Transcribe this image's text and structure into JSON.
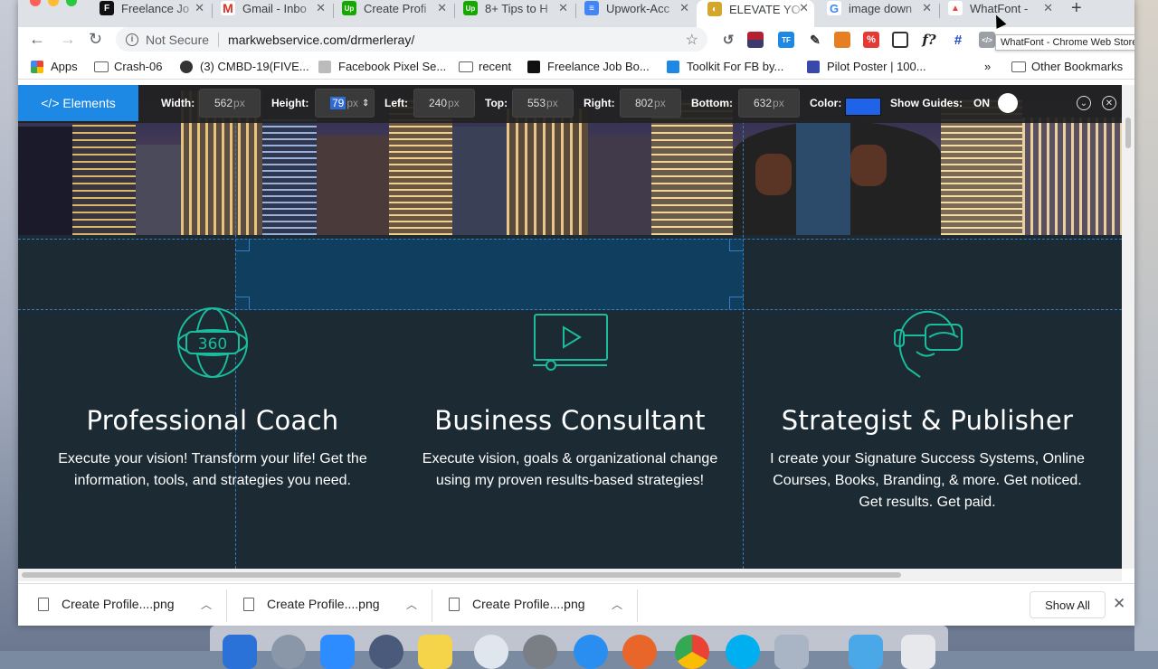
{
  "browser": {
    "tabs": [
      {
        "title": "Freelance Jo",
        "fav": "F",
        "favColor": "#111"
      },
      {
        "title": "Gmail - Inbo",
        "fav": "M",
        "favColor": "#d93025"
      },
      {
        "title": "Create Profi",
        "fav": "Up",
        "favColor": "#14a800"
      },
      {
        "title": "8+ Tips to H",
        "fav": "Up",
        "favColor": "#14a800"
      },
      {
        "title": "Upwork-Acc",
        "fav": "≡",
        "favColor": "#4285f4"
      },
      {
        "title": "ELEVATE YO",
        "fav": "◐",
        "favColor": "#d4a62a"
      },
      {
        "title": "image down",
        "fav": "G",
        "favColor": "#4285f4"
      },
      {
        "title": "WhatFont -",
        "fav": "▲",
        "favColor": "#e94335"
      }
    ],
    "security_label": "Not Secure",
    "url": "markwebservice.com/drmerleray/",
    "tooltip": "WhatFont - Chrome Web Store",
    "bookmarks": [
      {
        "label": "Apps",
        "icon": "apps-grid-icon"
      },
      {
        "label": "Crash-06",
        "icon": "folder-icon"
      },
      {
        "label": "(3) CMBD-19(FIVE...",
        "icon": "site-icon"
      },
      {
        "label": "Facebook Pixel Se...",
        "icon": "site-icon"
      },
      {
        "label": "recent",
        "icon": "folder-icon"
      },
      {
        "label": "Freelance Job Bo...",
        "icon": "freelancer-icon"
      },
      {
        "label": "Toolkit For FB by...",
        "icon": "toolkit-icon"
      },
      {
        "label": "Pilot Poster | 100...",
        "icon": "pilot-icon"
      }
    ],
    "bookmarks_more": "»",
    "other_bookmarks": "Other Bookmarks"
  },
  "whatfont": {
    "logo": "</> Elements",
    "width_label": "Width:",
    "width_value": "562",
    "height_label": "Height:",
    "height_value": "79",
    "left_label": "Left:",
    "left_value": "240",
    "top_label": "Top:",
    "top_value": "553",
    "right_label": "Right:",
    "right_value": "802",
    "bottom_label": "Bottom:",
    "bottom_value": "632",
    "unit": "px",
    "color_label": "Color:",
    "guide_color": "#1f63e8",
    "guides_label": "Show Guides:",
    "guides_state": "ON"
  },
  "services": [
    {
      "title": "Professional Coach",
      "text": "Execute your vision! Transform your life! Get the information, tools, and strategies you need.",
      "icon": "360-globe-icon"
    },
    {
      "title": "Business Consultant",
      "text": "Execute vision, goals & organizational change using my proven results-based strategies!",
      "icon": "video-play-icon"
    },
    {
      "title": "Strategist & Publisher",
      "text": "I create your Signature Success Systems, Online Courses, Books, Branding, & more. Get noticed. Get results. Get paid.",
      "icon": "vr-headset-icon"
    }
  ],
  "accent_color": "#1abc9c",
  "downloads": {
    "items": [
      "Create Profile....png",
      "Create Profile....png",
      "Create Profile....png"
    ],
    "show_all": "Show All"
  }
}
